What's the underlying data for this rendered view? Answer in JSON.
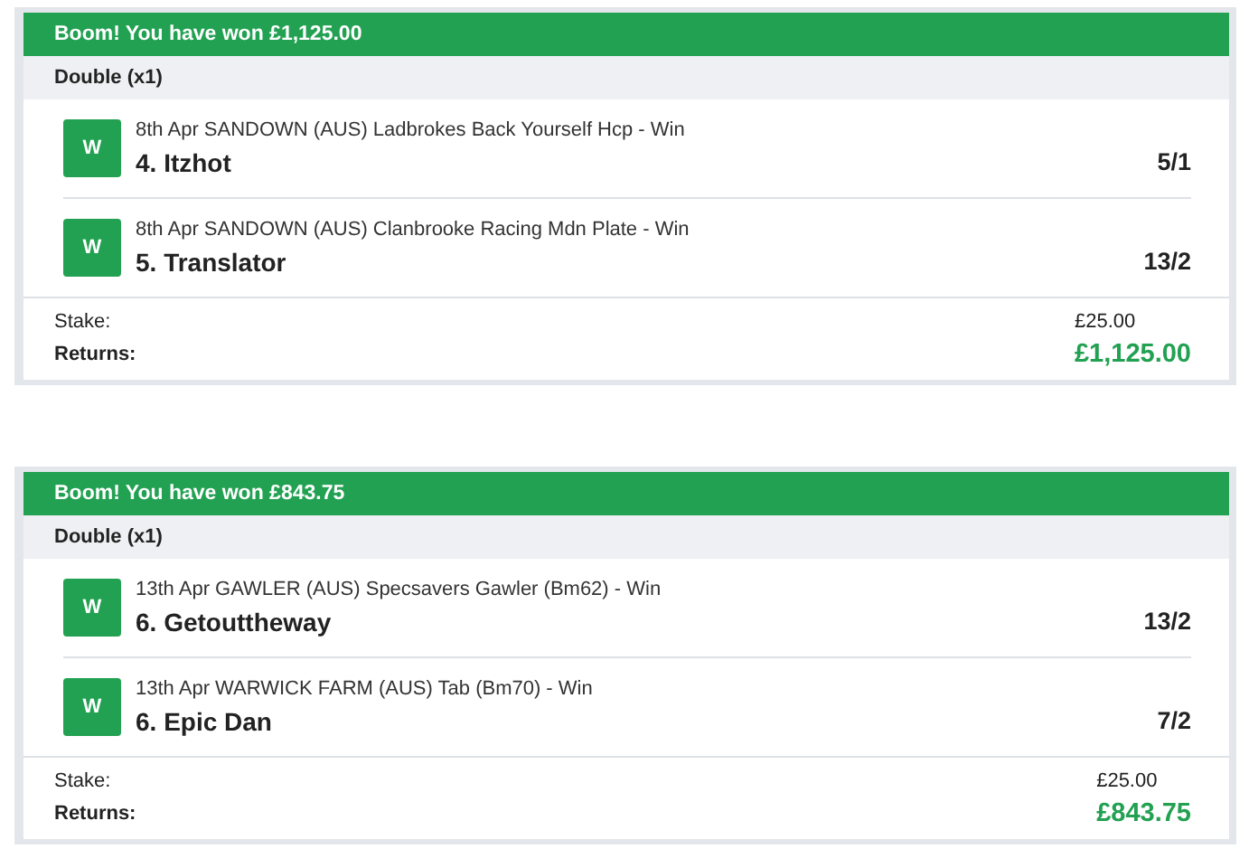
{
  "bets": [
    {
      "banner": "Boom! You have won £1,125.00",
      "bet_type": "Double (x1)",
      "legs": [
        {
          "result": "W",
          "event": "8th Apr SANDOWN (AUS) Ladbrokes Back Yourself Hcp - Win",
          "selection": "4. Itzhot",
          "odds": "5/1"
        },
        {
          "result": "W",
          "event": "8th Apr SANDOWN (AUS) Clanbrooke Racing Mdn Plate - Win",
          "selection": "5. Translator",
          "odds": "13/2"
        }
      ],
      "stake_label": "Stake:",
      "stake": "£25.00",
      "returns_label": "Returns:",
      "returns": "£1,125.00"
    },
    {
      "banner": "Boom! You have won £843.75",
      "bet_type": "Double (x1)",
      "legs": [
        {
          "result": "W",
          "event": "13th Apr GAWLER (AUS) Specsavers Gawler (Bm62) - Win",
          "selection": "6. Getouttheway",
          "odds": "13/2"
        },
        {
          "result": "W",
          "event": "13th Apr WARWICK FARM (AUS) Tab (Bm70) - Win",
          "selection": "6. Epic Dan",
          "odds": "7/2"
        }
      ],
      "stake_label": "Stake:",
      "stake": "£25.00",
      "returns_label": "Returns:",
      "returns": "£843.75"
    }
  ]
}
